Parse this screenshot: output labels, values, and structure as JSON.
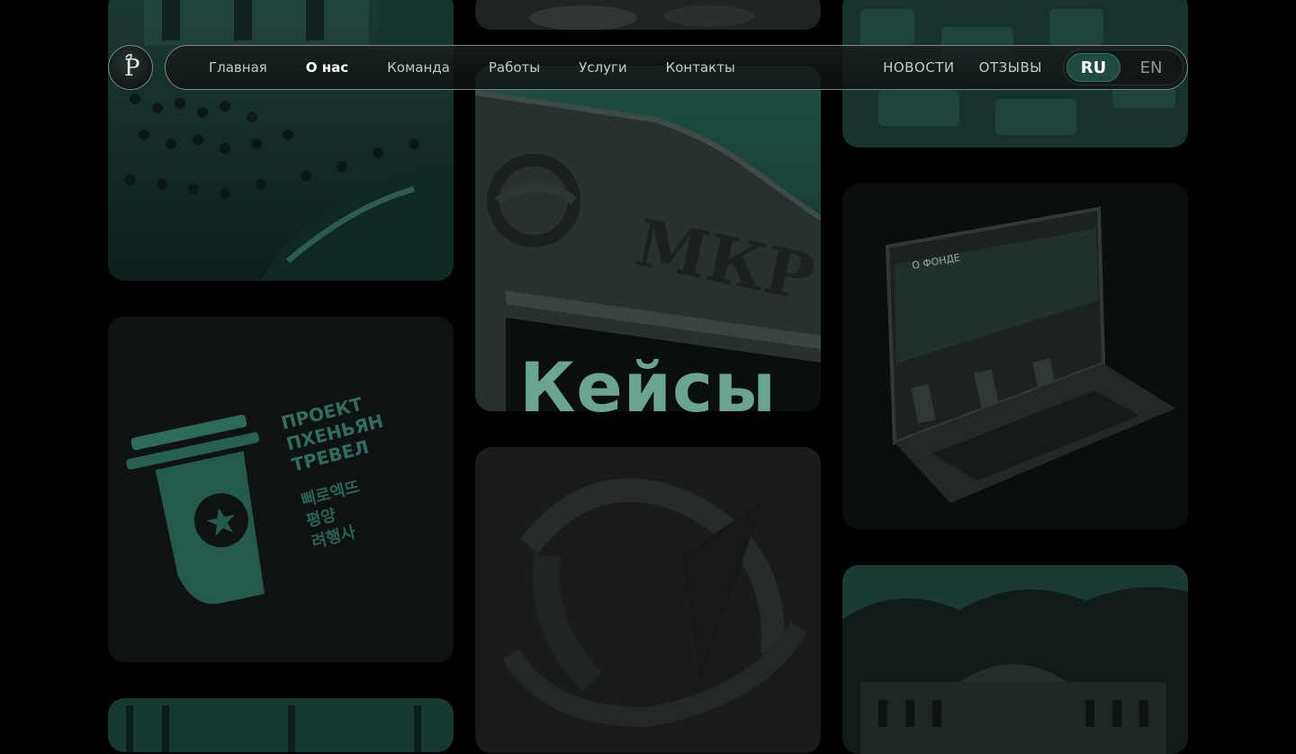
{
  "logo": {
    "letter": "P",
    "icon": "horse-letter-logo"
  },
  "nav": {
    "links": [
      "Главная",
      "О нас",
      "Команда",
      "Работы",
      "Услуги",
      "Контакты"
    ],
    "active": "О нас",
    "news": "НОВОСТИ",
    "reviews": "ОТЗЫВЫ"
  },
  "lang": {
    "ru": "RU",
    "en": "EN",
    "active": "RU"
  },
  "hero": {
    "title": "Кейсы"
  },
  "cards": {
    "mkr_text": "МКР",
    "pyongyang": [
      "ПРОЕКТ",
      "ПХЕНЬЯН",
      "ТРЕВЕЛ"
    ],
    "korean": [
      "삐로엑뜨",
      "평양",
      "려행사"
    ],
    "laptop_heading": "О ФОНДЕ"
  },
  "colors": {
    "accent": "#6aa593",
    "background": "#000000",
    "toggle_active": "#1e4a40"
  }
}
